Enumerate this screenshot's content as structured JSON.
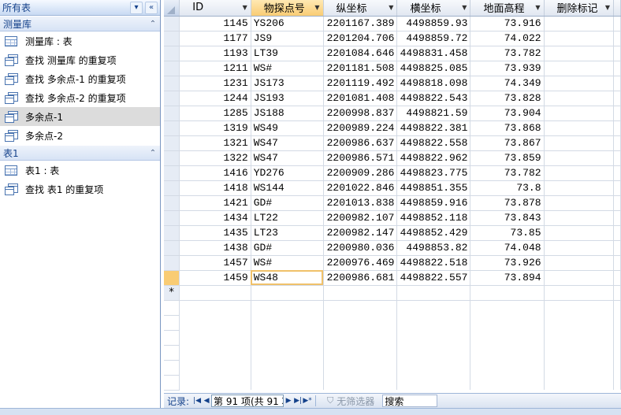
{
  "nav": {
    "header_title": "所有表",
    "groups": [
      {
        "label": "测量库",
        "items": [
          {
            "label": "测量库 : 表",
            "type": "table"
          },
          {
            "label": "查找 测量库 的重复项",
            "type": "query"
          },
          {
            "label": "查找 多余点-1 的重复项",
            "type": "query"
          },
          {
            "label": "查找 多余点-2 的重复项",
            "type": "query"
          },
          {
            "label": "多余点-1",
            "type": "query",
            "selected": true
          },
          {
            "label": "多余点-2",
            "type": "query"
          }
        ]
      },
      {
        "label": "表1",
        "items": [
          {
            "label": "表1 : 表",
            "type": "table"
          },
          {
            "label": "查找 表1 的重复项",
            "type": "query"
          }
        ]
      }
    ]
  },
  "datasheet": {
    "columns": [
      "ID",
      "物探点号",
      "纵坐标",
      "横坐标",
      "地面高程",
      "删除标记"
    ],
    "sorted_column_index": 1,
    "rows": [
      [
        "1145",
        "YS206",
        "2201167.389",
        "4498859.93",
        "73.916",
        ""
      ],
      [
        "1177",
        "JS9",
        "2201204.706",
        "4498859.72",
        "74.022",
        ""
      ],
      [
        "1193",
        "LT39",
        "2201084.646",
        "4498831.458",
        "73.782",
        ""
      ],
      [
        "1211",
        "WS#",
        "2201181.508",
        "4498825.085",
        "73.939",
        ""
      ],
      [
        "1231",
        "JS173",
        "2201119.492",
        "4498818.098",
        "74.349",
        ""
      ],
      [
        "1244",
        "JS193",
        "2201081.408",
        "4498822.543",
        "73.828",
        ""
      ],
      [
        "1285",
        "JS188",
        "2200998.837",
        "4498821.59",
        "73.904",
        ""
      ],
      [
        "1319",
        "WS49",
        "2200989.224",
        "4498822.381",
        "73.868",
        ""
      ],
      [
        "1321",
        "WS47",
        "2200986.637",
        "4498822.558",
        "73.867",
        ""
      ],
      [
        "1322",
        "WS47",
        "2200986.571",
        "4498822.962",
        "73.859",
        ""
      ],
      [
        "1416",
        "YD276",
        "2200909.286",
        "4498823.775",
        "73.782",
        ""
      ],
      [
        "1418",
        "WS144",
        "2201022.846",
        "4498851.355",
        "73.8",
        ""
      ],
      [
        "1421",
        "GD#",
        "2201013.838",
        "4498859.916",
        "73.878",
        ""
      ],
      [
        "1434",
        "LT22",
        "2200982.107",
        "4498852.118",
        "73.843",
        ""
      ],
      [
        "1435",
        "LT23",
        "2200982.147",
        "4498852.429",
        "73.85",
        ""
      ],
      [
        "1438",
        "GD#",
        "2200980.036",
        "4498853.82",
        "74.048",
        ""
      ],
      [
        "1457",
        "WS#",
        "2200976.469",
        "4498822.518",
        "73.926",
        ""
      ],
      [
        "1459",
        "WS48",
        "2200986.681",
        "4498822.557",
        "73.894",
        ""
      ]
    ],
    "current_row_index": 17,
    "new_record_marker": "*"
  },
  "record_bar": {
    "label": "记录:",
    "first_icon": "first-record-icon",
    "prev_icon": "prev-record-icon",
    "position_text": "第 91 项(共 91 项",
    "next_icon": "next-record-icon",
    "last_icon": "last-record-icon",
    "new_icon": "new-record-icon",
    "filter_label": "无筛选器",
    "search_label": "搜索"
  },
  "colors": {
    "accent": "#15428b",
    "sorted_header": "#f9cc74",
    "selector": "#e6ecf5"
  }
}
